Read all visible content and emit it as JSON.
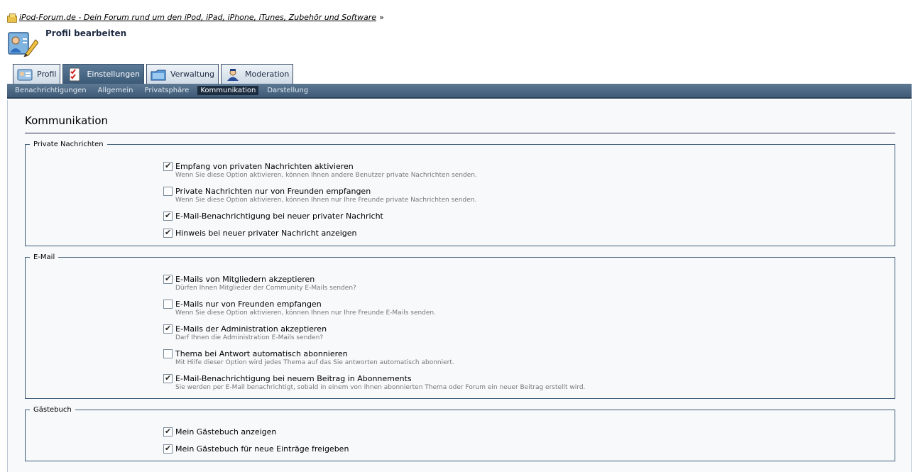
{
  "breadcrumb": {
    "link": "iPod-Forum.de - Dein Forum rund um den iPod, iPad, iPhone, iTunes, Zubehör und Software",
    "separator": "»"
  },
  "page": {
    "title": "Profil bearbeiten"
  },
  "tabs": [
    {
      "label": "Profil",
      "icon": "profile-card-icon",
      "active": false
    },
    {
      "label": "Einstellungen",
      "icon": "checklist-icon",
      "active": true
    },
    {
      "label": "Verwaltung",
      "icon": "folder-icon",
      "active": false
    },
    {
      "label": "Moderation",
      "icon": "moderator-icon",
      "active": false
    }
  ],
  "subnav": [
    {
      "label": "Benachrichtigungen",
      "active": false
    },
    {
      "label": "Allgemein",
      "active": false
    },
    {
      "label": "Privatsphäre",
      "active": false
    },
    {
      "label": "Kommunikation",
      "active": true
    },
    {
      "label": "Darstellung",
      "active": false
    }
  ],
  "content": {
    "title": "Kommunikation",
    "sections": [
      {
        "legend": "Private Nachrichten",
        "options": [
          {
            "label": "Empfang von privaten Nachrichten aktivieren",
            "desc": "Wenn Sie diese Option aktivieren, können Ihnen andere Benutzer private Nachrichten senden.",
            "checked": true
          },
          {
            "label": "Private Nachrichten nur von Freunden empfangen",
            "desc": "Wenn Sie diese Option aktivieren, können Ihnen nur Ihre Freunde private Nachrichten senden.",
            "checked": false
          },
          {
            "label": "E-Mail-Benachrichtigung bei neuer privater Nachricht",
            "desc": "",
            "checked": true
          },
          {
            "label": "Hinweis bei neuer privater Nachricht anzeigen",
            "desc": "",
            "checked": true
          }
        ]
      },
      {
        "legend": "E-Mail",
        "options": [
          {
            "label": "E-Mails von Mitgliedern akzeptieren",
            "desc": "Dürfen Ihnen Mitglieder der Community E-Mails senden?",
            "checked": true
          },
          {
            "label": "E-Mails nur von Freunden empfangen",
            "desc": "Wenn Sie diese Option aktivieren, können Ihnen nur Ihre Freunde E-Mails senden.",
            "checked": false
          },
          {
            "label": "E-Mails der Administration akzeptieren",
            "desc": "Darf Ihnen die Administration E-Mails senden?",
            "checked": true
          },
          {
            "label": "Thema bei Antwort automatisch abonnieren",
            "desc": "Mit Hilfe dieser Option wird jedes Thema auf das Sie antworten automatisch abonniert.",
            "checked": false
          },
          {
            "label": "E-Mail-Benachrichtigung bei neuem Beitrag in Abonnements",
            "desc": "Sie werden per E-Mail benachrichtigt, sobald in einem von Ihnen abonnierten Thema oder Forum ein neuer Beitrag erstellt wird.",
            "checked": true
          }
        ]
      },
      {
        "legend": "Gästebuch",
        "options": [
          {
            "label": "Mein Gästebuch anzeigen",
            "desc": "",
            "checked": true
          },
          {
            "label": "Mein Gästebuch für neue Einträge freigeben",
            "desc": "",
            "checked": true
          }
        ]
      }
    ]
  }
}
